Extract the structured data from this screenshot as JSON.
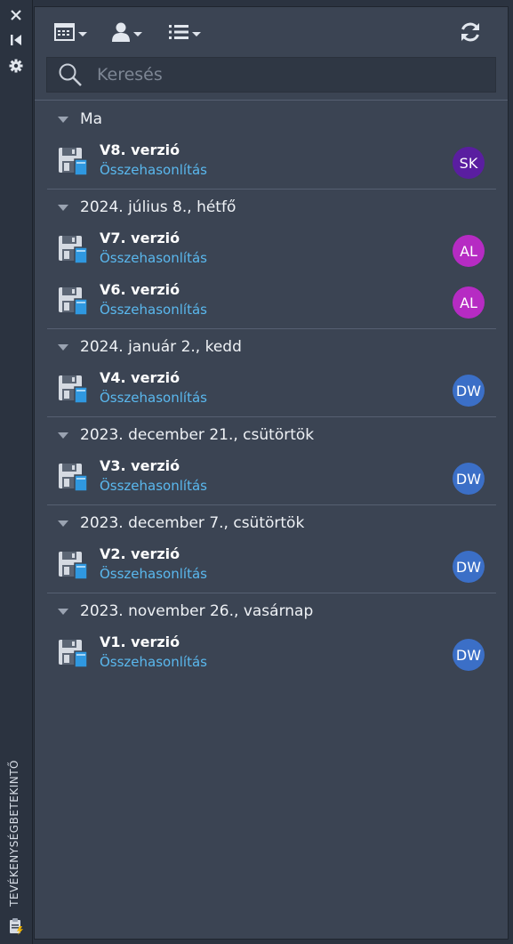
{
  "side_strip": {
    "vertical_title": "TEVÉKENYSÉGBETEKINTŐ",
    "icons": [
      "close-icon",
      "collapse-icon",
      "gear-icon",
      "activity-log-icon"
    ]
  },
  "toolbar": {
    "icons": [
      "calendar-icon",
      "user-icon",
      "list-icon",
      "refresh-icon"
    ]
  },
  "search": {
    "placeholder": "Keresés"
  },
  "colors": {
    "link": "#5ab8ee",
    "avatar_SK": "#5a1ea0",
    "avatar_AL": "#b62bc3",
    "avatar_DW": "#3b6fc7"
  },
  "groups": [
    {
      "title": "Ma",
      "entries": [
        {
          "version": "V8. verzió",
          "link": "Összehasonlítás",
          "initials": "SK"
        }
      ]
    },
    {
      "title": "2024. július 8., hétfő",
      "entries": [
        {
          "version": "V7. verzió",
          "link": "Összehasonlítás",
          "initials": "AL"
        },
        {
          "version": "V6. verzió",
          "link": "Összehasonlítás",
          "initials": "AL"
        }
      ]
    },
    {
      "title": "2024. január 2., kedd",
      "entries": [
        {
          "version": "V4. verzió",
          "link": "Összehasonlítás",
          "initials": "DW"
        }
      ]
    },
    {
      "title": "2023. december 21., csütörtök",
      "entries": [
        {
          "version": "V3. verzió",
          "link": "Összehasonlítás",
          "initials": "DW"
        }
      ]
    },
    {
      "title": "2023. december 7., csütörtök",
      "entries": [
        {
          "version": "V2. verzió",
          "link": "Összehasonlítás",
          "initials": "DW"
        }
      ]
    },
    {
      "title": "2023. november 26., vasárnap",
      "entries": [
        {
          "version": "V1. verzió",
          "link": "Összehasonlítás",
          "initials": "DW"
        }
      ]
    }
  ]
}
